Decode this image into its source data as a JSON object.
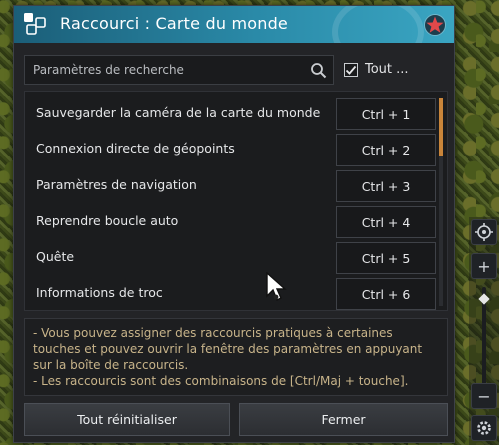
{
  "window": {
    "title": "Raccourci : Carte du monde",
    "colors": {
      "titlebar": "#2a8aa8",
      "info_text": "#c8b48a",
      "scroll_accent": "#c9853a",
      "close_star": "#e0484a"
    }
  },
  "search": {
    "placeholder": "Paramètres de recherche",
    "checkbox_label": "Tout ...",
    "checkbox_checked": true
  },
  "shortcuts": [
    {
      "label": "Sauvegarder la caméra de la carte du monde",
      "key": "Ctrl + 1"
    },
    {
      "label": "Connexion directe de géopoints",
      "key": "Ctrl + 2"
    },
    {
      "label": "Paramètres de navigation",
      "key": "Ctrl + 3"
    },
    {
      "label": "Reprendre boucle auto",
      "key": "Ctrl + 4"
    },
    {
      "label": "Quête",
      "key": "Ctrl + 5"
    },
    {
      "label": "Informations de troc",
      "key": "Ctrl + 6"
    }
  ],
  "info": {
    "line1": "- Vous pouvez assigner des raccourcis pratiques à certaines touches et pouvez ouvrir la fenêtre des paramètres en appuyant sur la boîte de raccourcis.",
    "line2": "- Les raccourcis sont des combinaisons de [Ctrl/Maj + touche]."
  },
  "buttons": {
    "reset": "Tout réinitialiser",
    "close": "Fermer"
  },
  "map_controls": {
    "icons": [
      "locate-icon",
      "zoom-in-icon",
      "zoom-out-icon",
      "gear-icon"
    ],
    "plus": "+",
    "minus": "−"
  }
}
